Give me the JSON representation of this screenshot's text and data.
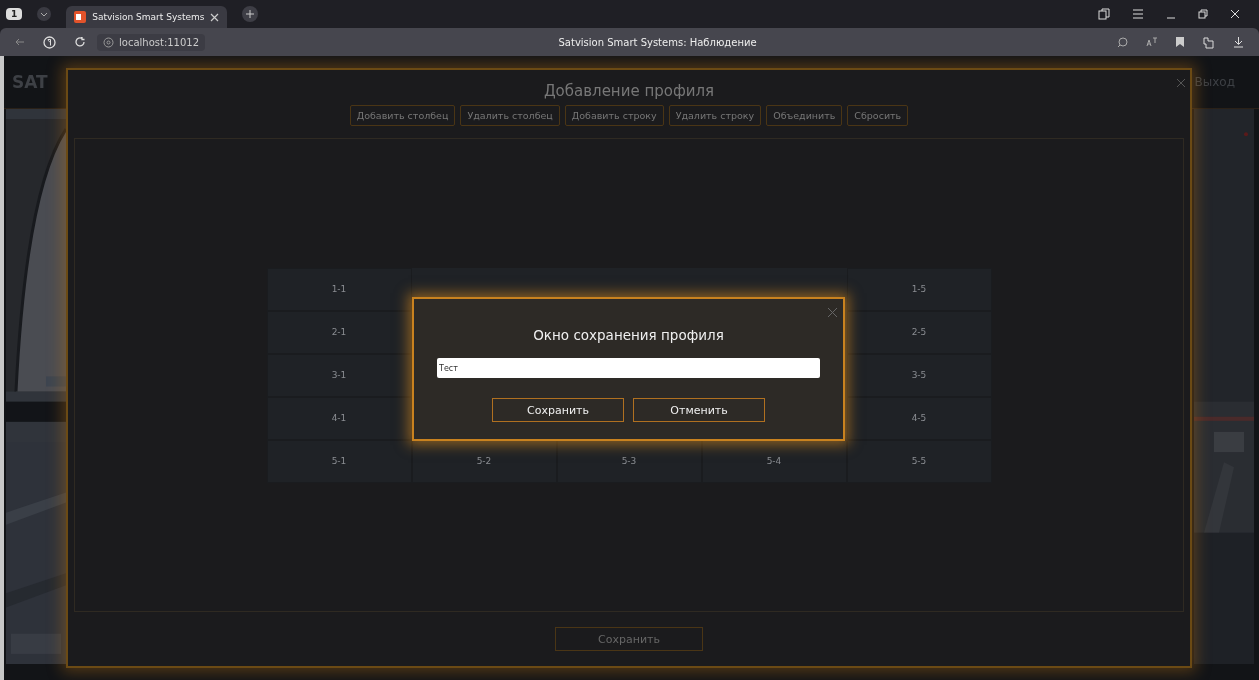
{
  "browser": {
    "tab_badge": "1",
    "tab_title": "Satvision Smart Systems",
    "address": "localhost:11012",
    "page_title": "Satvision Smart Systems: Наблюдение"
  },
  "app": {
    "logo": "SAT",
    "logout": "Выход"
  },
  "profile_dialog": {
    "title": "Добавление профиля",
    "actions": [
      "Добавить столбец",
      "Удалить столбец",
      "Добавить строку",
      "Удалить строку",
      "Объединить",
      "Сбросить"
    ],
    "grid_rows": [
      [
        "1-1",
        "1-5"
      ],
      [
        "2-1",
        "2-5"
      ],
      [
        "3-1",
        "3-5"
      ],
      [
        "4-1",
        "4-5"
      ],
      [
        "5-1",
        "5-2",
        "5-3",
        "5-4",
        "5-5"
      ]
    ],
    "save": "Сохранить"
  },
  "save_dialog": {
    "title": "Окно сохранения профиля",
    "name_value": "Тест",
    "buttons": [
      "Сохранить",
      "Отменить"
    ]
  }
}
